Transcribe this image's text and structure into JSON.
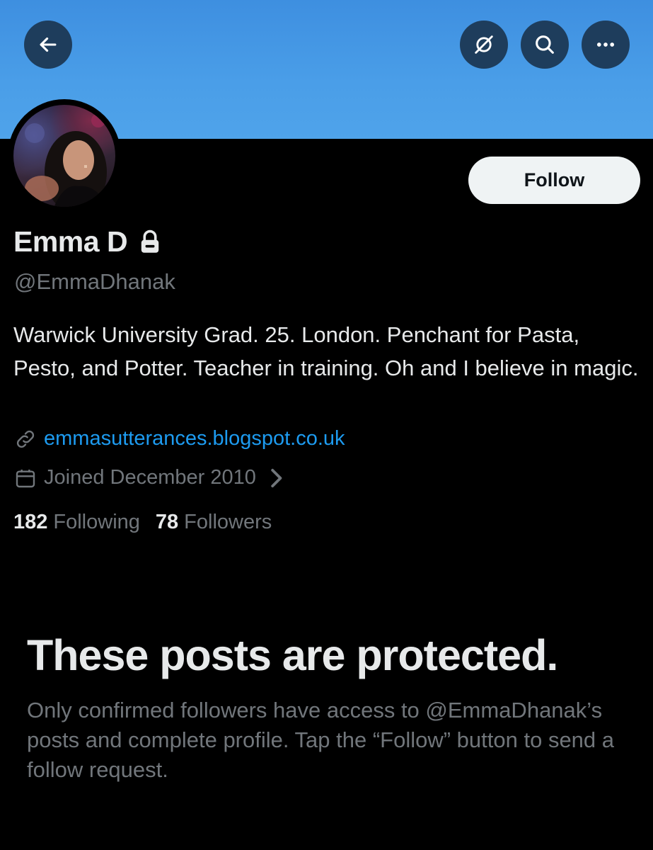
{
  "header": {
    "back_icon": "arrow-left-icon",
    "grok_icon": "grok-icon",
    "search_icon": "search-icon",
    "more_icon": "more-horizontal-icon",
    "banner_color": "#4a9ee8"
  },
  "profile": {
    "follow_label": "Follow",
    "name": "Emma D",
    "handle": "@EmmaDhanak",
    "bio": "Warwick University Grad. 25. London. Penchant for Pasta, Pesto, and Potter. Teacher in training. Oh and I believe in magic.",
    "website": "emmasutterances.blogspot.co.uk",
    "joined": "Joined December 2010",
    "following_count": "182",
    "following_label": "Following",
    "followers_count": "78",
    "followers_label": "Followers"
  },
  "protected": {
    "title": "These posts are protected.",
    "body": "Only confirmed followers have access to @EmmaDhanak’s posts and complete profile. Tap the “Follow” button to send a follow request."
  },
  "colors": {
    "link": "#1d9bf0",
    "secondary_text": "#71767b",
    "primary_text": "#e7e9ea"
  }
}
